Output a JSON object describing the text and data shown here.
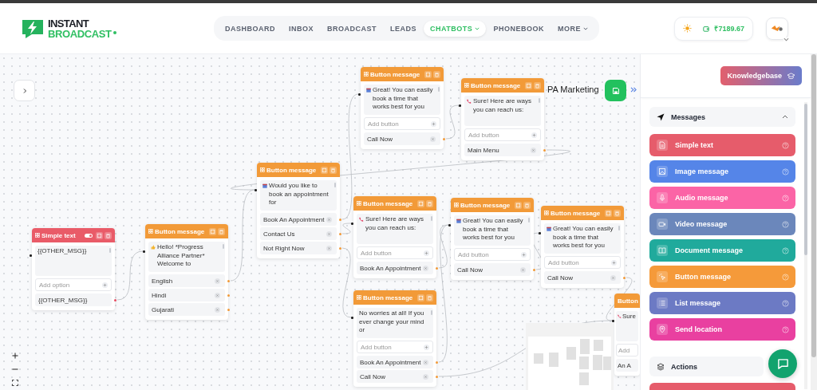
{
  "logo": {
    "line1": "INSTANT",
    "line2": "BROADCAST"
  },
  "nav": [
    {
      "label": "DASHBOARD",
      "selected": false,
      "dropdown": false
    },
    {
      "label": "INBOX",
      "selected": false,
      "dropdown": false
    },
    {
      "label": "BROADCAST",
      "selected": false,
      "dropdown": false
    },
    {
      "label": "LEADS",
      "selected": false,
      "dropdown": false
    },
    {
      "label": "CHATBOTS",
      "selected": true,
      "dropdown": true
    },
    {
      "label": "PHONEBOOK",
      "selected": false,
      "dropdown": false
    },
    {
      "label": "MORE",
      "selected": false,
      "dropdown": true
    }
  ],
  "wallet": {
    "balance": "₹7189.67"
  },
  "flow": {
    "name": "PA Marketing",
    "nodes": [
      {
        "kind": "simple_text",
        "title": "Simple text",
        "enabled": true,
        "message": "{{OTHER_MSG}}",
        "add_placeholder": "Add option",
        "options": [
          "{{OTHER_MSG}}"
        ]
      },
      {
        "kind": "button",
        "title": "Button message",
        "message": "Hello! *Progress Alliance Partner* Welcome to",
        "options": [
          "English",
          "Hindi",
          "Gujarati"
        ]
      },
      {
        "kind": "button",
        "title": "Button message",
        "message": "Would you like to book an appointment for",
        "options": [
          "Book An Appointment",
          "Contact Us",
          "Not Right Now"
        ]
      },
      {
        "kind": "button",
        "title": "Button message",
        "message": "Great! You can easily book a time that works best for you",
        "add_placeholder": "Add button",
        "options": [
          "Call Now"
        ]
      },
      {
        "kind": "button",
        "title": "Button message",
        "message": "Sure! Here are ways you can reach us:",
        "add_placeholder": "Add button",
        "options": [
          "Main Menu"
        ]
      },
      {
        "kind": "button",
        "title": "Button message",
        "message": "Sure! Here are ways you can reach us:",
        "add_placeholder": "Add button",
        "options": [
          "Book An Appointment"
        ]
      },
      {
        "kind": "button",
        "title": "Button message",
        "message": "Great! You can easily book a time that works best for you",
        "add_placeholder": "Add button",
        "options": [
          "Call Now"
        ]
      },
      {
        "kind": "button",
        "title": "Button message",
        "message": "Great! You can easily book a time that works best for you",
        "add_placeholder": "Add button",
        "options": [
          "Call Now"
        ]
      },
      {
        "kind": "button",
        "title": "Button message",
        "message": "No worries at all! If you ever change your mind or",
        "add_placeholder": "Add button",
        "options": [
          "Book An Appointment",
          "Call Now"
        ]
      },
      {
        "kind": "button",
        "title": "Button",
        "message": "Sure",
        "add_placeholder": "Add",
        "options": [
          "An A"
        ]
      }
    ]
  },
  "panel": {
    "knowledgebase": "Knowledgebase",
    "sections": [
      {
        "title": "Messages",
        "expanded": true,
        "items": [
          {
            "label": "Simple text",
            "kind": "text",
            "color": "#e65c6b"
          },
          {
            "label": "Image message",
            "kind": "image",
            "color": "#5585e8"
          },
          {
            "label": "Audio message",
            "kind": "audio",
            "color": "#fb64a6"
          },
          {
            "label": "Video message",
            "kind": "video",
            "color": "#6b87bb"
          },
          {
            "label": "Document message",
            "kind": "document",
            "color": "#20aa9c"
          },
          {
            "label": "Button message",
            "kind": "button",
            "color": "#f59a3a"
          },
          {
            "label": "List message",
            "kind": "list",
            "color": "#6c7ac4"
          },
          {
            "label": "Send location",
            "kind": "location",
            "color": "#e940a0"
          }
        ]
      },
      {
        "title": "Actions"
      }
    ]
  }
}
